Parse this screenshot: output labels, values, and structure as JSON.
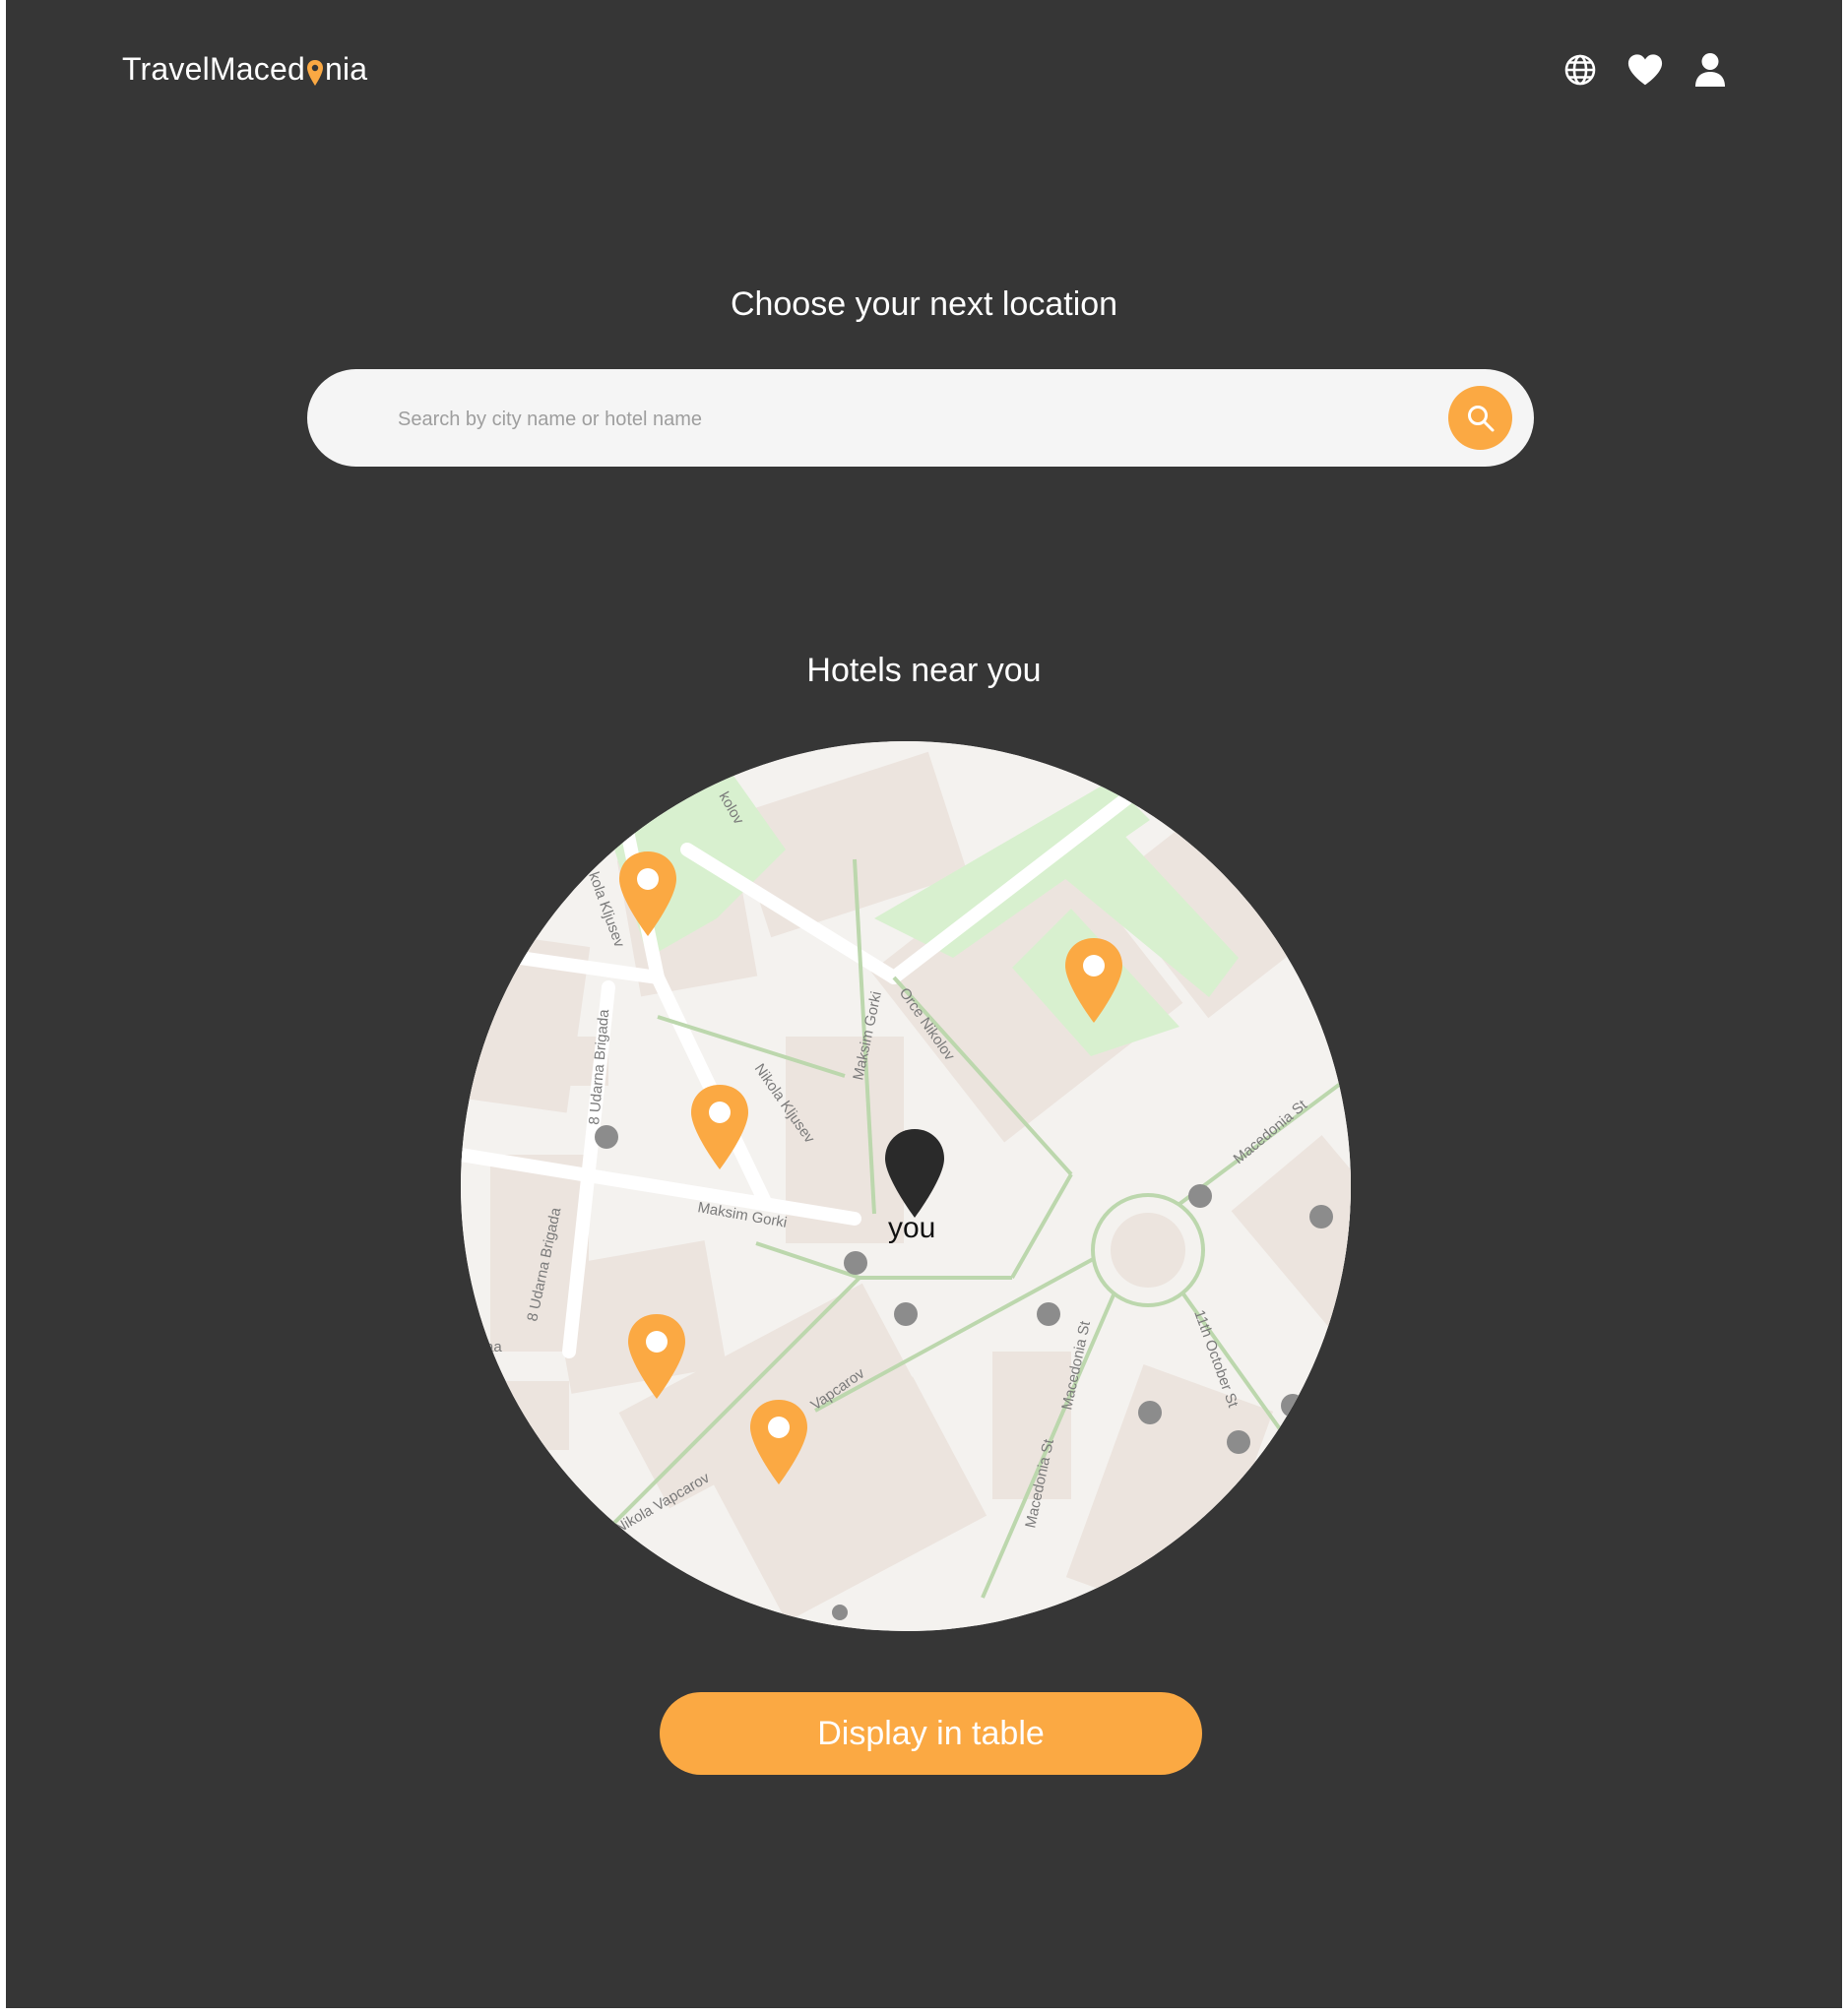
{
  "header": {
    "logo_text_before": "TravelMaced",
    "logo_text_after": "nia",
    "icons": [
      "globe-icon",
      "heart-icon",
      "user-icon"
    ]
  },
  "main": {
    "title": "Choose your next location",
    "search": {
      "placeholder": "Search by city name or hotel name",
      "value": ""
    },
    "map_section_title": "Hotels near you",
    "map": {
      "you_label": "you",
      "street_labels": [
        "kolov",
        "kola Kljusev",
        "Orce Nikolov",
        "Maksim Gorki",
        "Nikola Kljusev",
        "8 Udarna Brigada",
        "Maksim Gorki",
        "8 Udarna Brigada",
        "Macedonia St",
        "Macedonia St",
        "Macedonia St",
        "11th October St",
        "Vapcarov",
        "Nikola Vapcarov",
        "aa"
      ],
      "hotel_markers": 5
    },
    "display_table_button": "Display in table"
  },
  "colors": {
    "background": "#363636",
    "accent": "#fba943",
    "search_bg": "#f5f5f5",
    "map_bg": "#f4f2ef",
    "park": "#d8f0cf"
  }
}
